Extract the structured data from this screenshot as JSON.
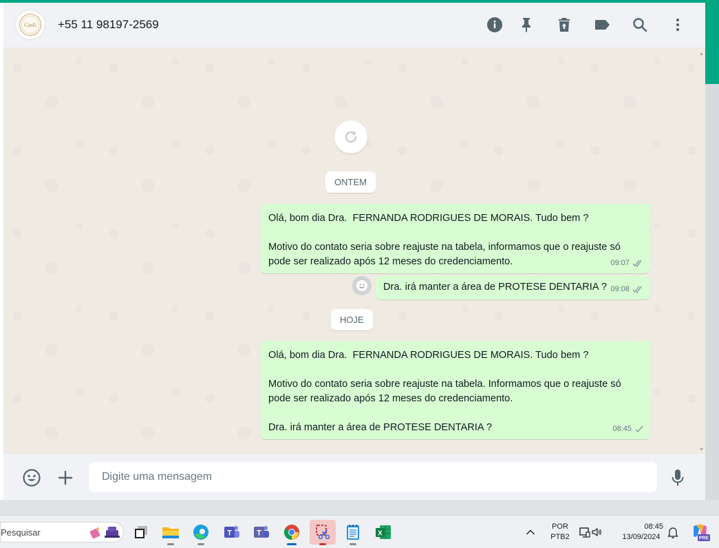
{
  "header": {
    "contact_name": "+55 11 98197-2569",
    "avatar_text": "GioR",
    "icons": [
      "info-icon",
      "pin-icon",
      "delete-icon",
      "label-icon",
      "search-icon",
      "more-icon"
    ]
  },
  "chat": {
    "date_chips": [
      "ONTEM",
      "HOJE"
    ],
    "messages": [
      {
        "text": "Olá, bom dia Dra.  FERNANDA RODRIGUES DE MORAIS. Tudo bem ?\n\nMotivo do contato seria sobre reajuste na tabela, informamos que o reajuste só pode ser realizado após 12 meses do credenciamento.",
        "time": "09:07",
        "status": "delivered"
      },
      {
        "text": "Dra. irá manter a área de PROTESE DENTARIA ?",
        "time": "09:08",
        "status": "delivered"
      },
      {
        "text": "Olá, bom dia Dra.  FERNANDA RODRIGUES DE MORAIS. Tudo bem ?\n\nMotivo do contato seria sobre reajuste na tabela. Informamos que o reajuste só pode ser realizado após 12 meses do credenciamento.\n\nDra. irá manter a área de PROTESE DENTARIA ?",
        "time": "08:45",
        "status": "sent"
      }
    ]
  },
  "composer": {
    "placeholder": "Digite uma mensagem"
  },
  "taskbar": {
    "search_label": "Pesquisar",
    "language": "POR",
    "keyboard": "PTB2",
    "time": "08:45",
    "date": "13/09/2024",
    "copilot_badge": "PRE",
    "apps": [
      "file-explorer",
      "edge",
      "teams-classic",
      "teams",
      "chrome",
      "snipping-tool",
      "notepad",
      "excel"
    ]
  },
  "colors": {
    "accent": "#00a884",
    "outgoing_bubble": "#d9fdd3",
    "chat_bg": "#efeae2"
  }
}
